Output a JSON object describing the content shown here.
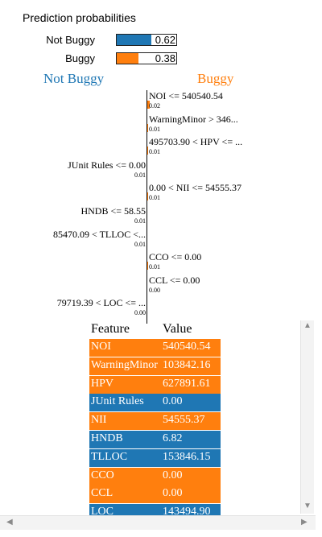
{
  "title": "Prediction probabilities",
  "colors": {
    "not_buggy": "#1f77b4",
    "buggy": "#ff7f0e"
  },
  "probabilities": [
    {
      "label": "Not Buggy",
      "value": "0.62",
      "fraction": 0.62,
      "color": "#1f77b4"
    },
    {
      "label": "Buggy",
      "value": "0.38",
      "fraction": 0.38,
      "color": "#ff7f0e"
    }
  ],
  "headers": {
    "left": "Not Buggy",
    "right": "Buggy"
  },
  "contributions": [
    {
      "name": "NOI <= 540540.54",
      "value": "0.02",
      "side": "right",
      "weight": 0.02
    },
    {
      "name": "WarningMinor > 346...",
      "value": "0.01",
      "side": "right",
      "weight": 0.01
    },
    {
      "name": "495703.90 < HPV <= ...",
      "value": "0.01",
      "side": "right",
      "weight": 0.01
    },
    {
      "name": "JUnit Rules <= 0.00",
      "value": "0.01",
      "side": "left",
      "weight": 0.01
    },
    {
      "name": "0.00 < NII <= 54555.37",
      "value": "0.01",
      "side": "right",
      "weight": 0.01
    },
    {
      "name": "HNDB <= 58.55",
      "value": "0.01",
      "side": "left",
      "weight": 0.01
    },
    {
      "name": "85470.09 < TLLOC <...",
      "value": "0.01",
      "side": "left",
      "weight": 0.01
    },
    {
      "name": "CCO <= 0.00",
      "value": "0.01",
      "side": "right",
      "weight": 0.01
    },
    {
      "name": "CCL <= 0.00",
      "value": "0.00",
      "side": "right",
      "weight": 0.0
    },
    {
      "name": "79719.39 < LOC <= ...",
      "value": "0.00",
      "side": "left",
      "weight": 0.0
    }
  ],
  "table": {
    "headers": {
      "feature": "Feature",
      "value": "Value"
    },
    "rows": [
      {
        "feature": "NOI",
        "value": "540540.54",
        "side": "right"
      },
      {
        "feature": "WarningMinor",
        "value": "103842.16",
        "side": "right"
      },
      {
        "feature": "HPV",
        "value": "627891.61",
        "side": "right"
      },
      {
        "feature": "JUnit Rules",
        "value": "0.00",
        "side": "left"
      },
      {
        "feature": "NII",
        "value": "54555.37",
        "side": "right"
      },
      {
        "feature": "HNDB",
        "value": "6.82",
        "side": "left"
      },
      {
        "feature": "TLLOC",
        "value": "153846.15",
        "side": "left"
      },
      {
        "feature": "CCO",
        "value": "0.00",
        "side": "right"
      },
      {
        "feature": "CCL",
        "value": "0.00",
        "side": "right"
      },
      {
        "feature": "LOC",
        "value": "143494.90",
        "side": "left"
      }
    ]
  },
  "scrollbars": {
    "up": "▲",
    "down": "▼",
    "left": "◀",
    "right": "▶"
  }
}
